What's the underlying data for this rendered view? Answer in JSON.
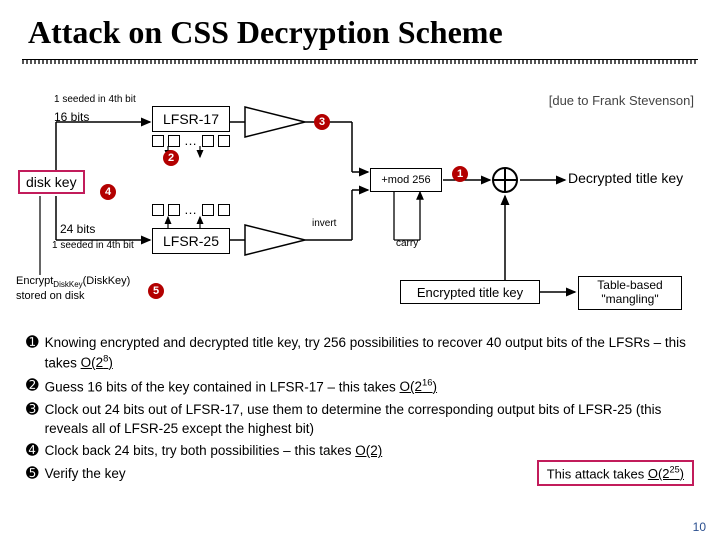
{
  "title": "Attack on CSS Decryption Scheme",
  "attribution": "[due to Frank Stevenson]",
  "labels": {
    "seeded_top": "1 seeded in 4th bit",
    "bits16": "16 bits",
    "lfsr17": "LFSR-17",
    "diskkey": "disk key",
    "bits24": "24 bits",
    "seeded_bot": "1 seeded in 4th bit",
    "lfsr25": "LFSR-25",
    "addmod": "+mod 256",
    "invert": "invert",
    "carry": "carry",
    "decrypted": "Decrypted title key",
    "encrypted": "Encrypted title key",
    "mangling_l1": "Table-based",
    "mangling_l2": "\"mangling\"",
    "stored_l1": "EncryptDiskKey(DiskKey)",
    "stored_suffix": "stored on disk",
    "dots": "…"
  },
  "markers": {
    "m1": "1",
    "m2": "2",
    "m3": "3",
    "m4": "4",
    "m5": "5"
  },
  "notes": {
    "n1": "Knowing encrypted and decrypted title key, try 256 possibilities to recover 40 output bits of the LFSRs – this takes ",
    "n1c": "O(2^8)",
    "n2": "Guess 16 bits of the key contained in LFSR-17 – this takes ",
    "n2c": "O(2^16)",
    "n3": "Clock out 24 bits out of LFSR-17, use them to determine the corresponding output bits of LFSR-25 (this reveals all of LFSR-25 except the highest bit)",
    "n4": "Clock back 24 bits, try both possibilities – this takes ",
    "n4c": "O(2)",
    "n5": "Verify the key"
  },
  "attack_cost": "This attack takes O(2^25)",
  "page": "10"
}
